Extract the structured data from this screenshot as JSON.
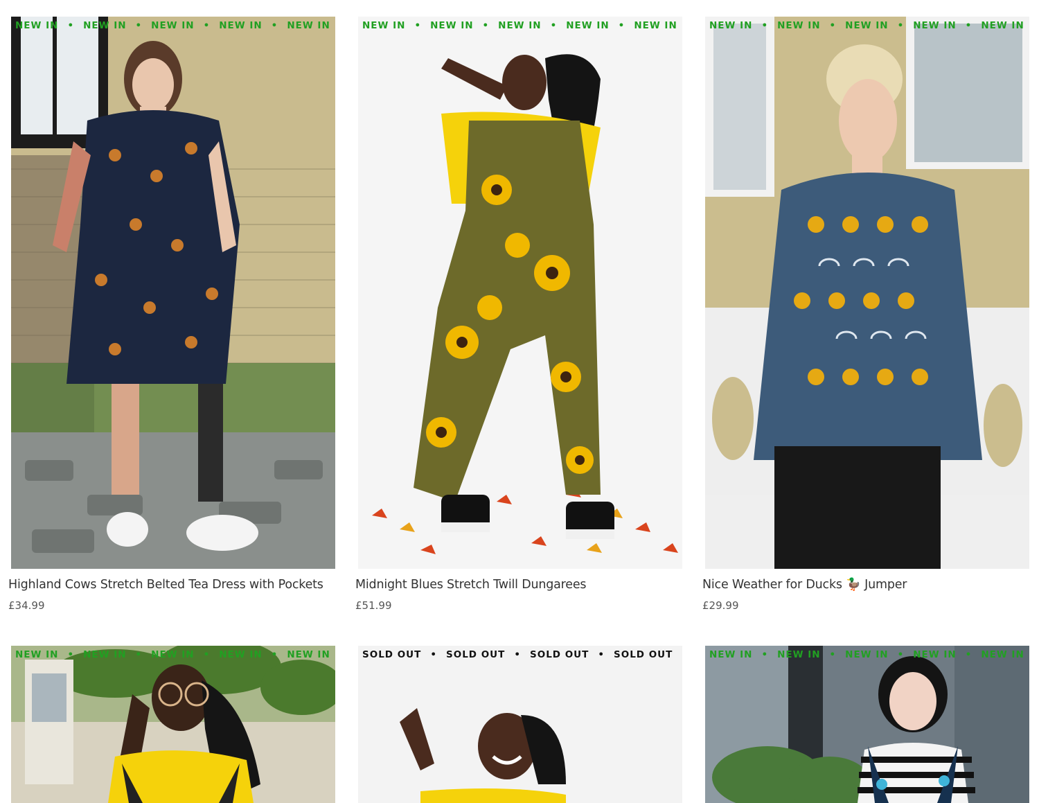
{
  "products": [
    {
      "badge": "NEW IN",
      "title": "Highland Cows Stretch Belted Tea Dress with Pockets",
      "price": "£34.99",
      "image_alt": "Model in navy highland cow print tea dress against a brick wall"
    },
    {
      "badge": "NEW IN",
      "title": "Midnight Blues Stretch Twill Dungarees",
      "price": "£51.99",
      "image_alt": "Model in sunflower print dungarees and yellow t-shirt with autumn leaves"
    },
    {
      "badge": "NEW IN",
      "title": "Nice Weather for Ducks 🦆 Jumper",
      "price": "£29.99",
      "image_alt": "Model in blue jumper with yellow ducks and umbrellas"
    },
    {
      "badge": "NEW IN",
      "image_alt": "Model in glasses and yellow t-shirt with printed dungarees"
    },
    {
      "badge": "SOLD OUT",
      "image_alt": "Smiling model in yellow t-shirt waving"
    },
    {
      "badge": "NEW IN",
      "image_alt": "Model in striped top and colourful dinosaur print dungarees"
    }
  ],
  "colors": {
    "new_in": "#21a022",
    "sold_out": "#111111",
    "text": "#333333"
  }
}
